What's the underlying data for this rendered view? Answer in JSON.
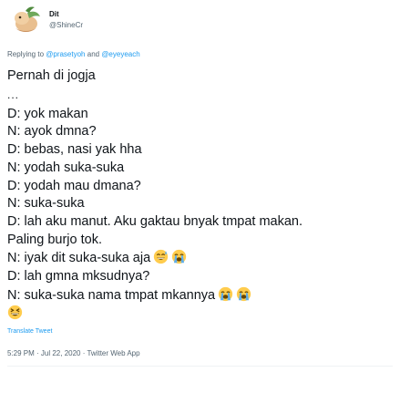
{
  "author": {
    "display_name": "Dit",
    "handle": "@ShineCr",
    "avatar_icon": "baby-bird-avatar"
  },
  "reply": {
    "prefix": "Replying to ",
    "mention1": "@prasetyoh",
    "joiner": " and ",
    "mention2": "@eyeyeach"
  },
  "tweet": {
    "lines": [
      "Pernah di jogja",
      "...",
      "D: yok makan",
      "N: ayok dmna?",
      "D: bebas, nasi yak hha",
      "N: yodah suka-suka",
      "D: yodah mau dmana?",
      "N: suka-suka",
      "D: lah aku manut. Aku gaktau bnyak tmpat makan.",
      "Paling burjo tok.",
      "N: iyak dit suka-suka aja",
      "D: lah gmna mksudnya?",
      "N: suka-suka nama tmpat mkannya"
    ],
    "emoji_names": {
      "sweat_smile": "grinning-sweat-face-icon",
      "crying": "loudly-crying-face-icon",
      "laughing": "grinning-squinting-face-icon"
    }
  },
  "translate_label": "Translate Tweet",
  "meta": {
    "time": "5:29 PM",
    "separator1": " · ",
    "date": "Jul 22, 2020",
    "separator2": " · ",
    "source": "Twitter Web App"
  },
  "colors": {
    "text": "#0f1419",
    "secondary": "#536471",
    "link": "#1d9bf0"
  }
}
